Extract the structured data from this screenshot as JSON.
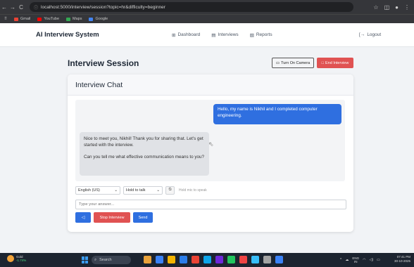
{
  "browser": {
    "url": "localhost:5000/interview/session?topic=hr&difficulty=beginner",
    "nav": [
      "←",
      "→",
      "C"
    ],
    "bookmarks": [
      {
        "label": "Gmail",
        "color": "#ea4335"
      },
      {
        "label": "YouTube",
        "color": "#ff0000"
      },
      {
        "label": "Maps",
        "color": "#34a853"
      },
      {
        "label": "Google",
        "color": "#4285f4"
      }
    ]
  },
  "header": {
    "brand": "AI Interview System",
    "nav": [
      {
        "label": "Dashboard",
        "icon": "dashboard-icon",
        "glyph": "⊞"
      },
      {
        "label": "Interviews",
        "icon": "clipboard-icon",
        "glyph": "▤"
      },
      {
        "label": "Reports",
        "icon": "document-icon",
        "glyph": "▧"
      }
    ],
    "logout": "Logout",
    "logout_glyph": "[→"
  },
  "session": {
    "title": "Interview Session",
    "camera_button": "Turn On Camera",
    "end_button": "End Interview",
    "end_color": "#e05252"
  },
  "chat": {
    "title": "Interview Chat",
    "user_message": "Hello, my name is Nikhil and I completed computer engineering.",
    "ai_message": [
      "Nice to meet you, Nikhil! Thank you for sharing that. Let's get started with the interview.",
      "Can you tell me what effective communication means to you?"
    ],
    "accent": "#2f6fe0"
  },
  "controls": {
    "language": "English (US)",
    "mode": "Hold to talk",
    "hint": "Hold mic to speak",
    "answer_placeholder": "Type your answer...",
    "stop_label": "Stop Interview",
    "send_label": "Send"
  },
  "taskbar": {
    "weather_label": "Gold",
    "weather_change": "-1.74%",
    "search": "Search",
    "lang": "ENG",
    "region": "IN",
    "time": "07:41 PM",
    "date": "30-10-2025",
    "apps": [
      "#e9a23b",
      "#3b82f6",
      "#f4b400",
      "#2b7de9",
      "#ea4335",
      "#0ea5e9",
      "#6d28d9",
      "#22c55e",
      "#ef4444",
      "#38bdf8",
      "#a3a3a3",
      "#3b82f6"
    ]
  }
}
